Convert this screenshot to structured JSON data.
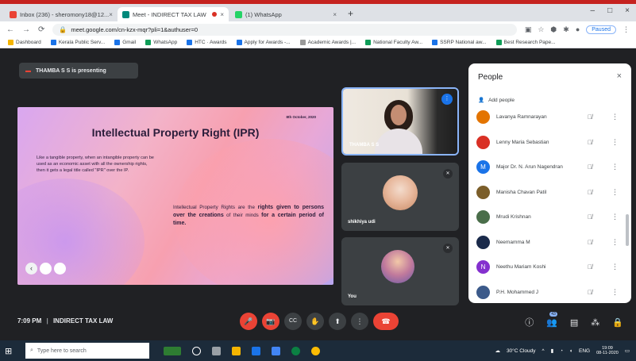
{
  "browser": {
    "tabs": [
      {
        "label": "Inbox (236) - sheromony18@12..."
      },
      {
        "label": "Meet - INDIRECT TAX LAW"
      },
      {
        "label": "(1) WhatsApp"
      }
    ],
    "new_tab": "+",
    "url": "meet.google.com/cn-kzx-mqr?pli=1&authuser=0",
    "paused_label": "Paused",
    "bookmarks": [
      {
        "label": "Dashboard",
        "color": "#f4b400"
      },
      {
        "label": "Kerala Public Serv...",
        "color": "#1a73e8"
      },
      {
        "label": "Gmail",
        "color": "#1a73e8"
      },
      {
        "label": "WhatsApp",
        "color": "#0f9d58"
      },
      {
        "label": "HTC · Awards",
        "color": "#1a73e8"
      },
      {
        "label": "Apply for Awards -...",
        "color": "#1a73e8"
      },
      {
        "label": "Academic Awards |...",
        "color": "#999999"
      },
      {
        "label": "National Faculty Aw...",
        "color": "#0f9d58"
      },
      {
        "label": "SSRP National aw...",
        "color": "#1a73e8"
      },
      {
        "label": "Best Research Pape...",
        "color": "#0f9d58"
      }
    ]
  },
  "meeting": {
    "presenting_label": "THAMBA S S is presenting",
    "time": "7:09 PM",
    "separator": "|",
    "title": "INDIRECT TAX LAW"
  },
  "slide": {
    "date": "8th October, 2020",
    "title": "Intellectual Property Right (IPR)",
    "paragraph1": "Like a tangible property, when an intangible property can be used as an economic asset with all the ownership rights, then it gets a legal title called \"IPR\" over the IP.",
    "p2_part1": "Intellectual Property Rights are the ",
    "p2_bold1": "rights given to persons over the creations",
    "p2_part2": " of their minds ",
    "p2_bold2": "for a certain period of time.",
    "nav_prev": "‹"
  },
  "tiles": [
    {
      "name": "THAMBA S S",
      "state": "speaking"
    },
    {
      "name": "shikhiya udi",
      "state": "muted"
    },
    {
      "name": "You",
      "state": "muted"
    }
  ],
  "people": {
    "title": "People",
    "close": "×",
    "add_label": "Add people",
    "participants": [
      {
        "name": "Lavanya Ramnarayan",
        "initial": "",
        "color": "#e37400"
      },
      {
        "name": "Lenny Maria Sebastian",
        "initial": "",
        "color": "#d93025"
      },
      {
        "name": "Major Dr. N. Arun Nagendran",
        "initial": "M",
        "color": "#1a73e8"
      },
      {
        "name": "Manisha Chavan Patil",
        "initial": "",
        "color": "#7b5e2a"
      },
      {
        "name": "Mrudi Krishnan",
        "initial": "",
        "color": "#4a6e4a"
      },
      {
        "name": "Neemamma M",
        "initial": "",
        "color": "#1a2a4a"
      },
      {
        "name": "Neethu Mariam Koshi",
        "initial": "N",
        "color": "#8430ce"
      },
      {
        "name": "P.H. Mohammed J",
        "initial": "",
        "color": "#3c5a8a"
      }
    ]
  },
  "controls": {
    "mic": "🎤",
    "cam": "📷",
    "cc": "CC",
    "hand": "✋",
    "present": "⬆",
    "more": "⋮",
    "end": "☎"
  },
  "right_controls": {
    "info": "ⓘ",
    "people": "👥",
    "people_count": "43",
    "chat": "▤",
    "activities": "⁂",
    "lock": "🔒"
  },
  "taskbar": {
    "search_placeholder": "Type here to search",
    "weather": "30°C Cloudy",
    "language": "ENG",
    "time": "19:09",
    "date": "08-11-2020"
  }
}
